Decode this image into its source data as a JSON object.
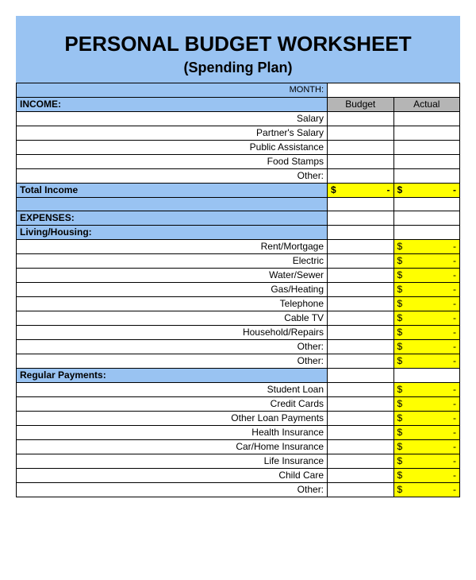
{
  "title": "PERSONAL BUDGET WORKSHEET",
  "subtitle": "(Spending Plan)",
  "month_label": "MONTH:",
  "month_value": "",
  "col_budget": "Budget",
  "col_actual": "Actual",
  "income_header": "INCOME:",
  "income_items": [
    {
      "label": "Salary",
      "budget": "",
      "actual": ""
    },
    {
      "label": "Partner's Salary",
      "budget": "",
      "actual": ""
    },
    {
      "label": "Public Assistance",
      "budget": "",
      "actual": ""
    },
    {
      "label": "Food Stamps",
      "budget": "",
      "actual": ""
    },
    {
      "label": "Other:",
      "budget": "",
      "actual": ""
    }
  ],
  "total_income_label": "Total Income",
  "total_income_budget": {
    "sym": "$",
    "dash": "-"
  },
  "total_income_actual": {
    "sym": "$",
    "dash": "-"
  },
  "expenses_header": "EXPENSES:",
  "living_header": "Living/Housing:",
  "living_items": [
    {
      "label": "Rent/Mortgage",
      "budget": "",
      "actual": {
        "sym": "$",
        "dash": "-"
      }
    },
    {
      "label": "Electric",
      "budget": "",
      "actual": {
        "sym": "$",
        "dash": "-"
      }
    },
    {
      "label": "Water/Sewer",
      "budget": "",
      "actual": {
        "sym": "$",
        "dash": "-"
      }
    },
    {
      "label": "Gas/Heating",
      "budget": "",
      "actual": {
        "sym": "$",
        "dash": "-"
      }
    },
    {
      "label": "Telephone",
      "budget": "",
      "actual": {
        "sym": "$",
        "dash": "-"
      }
    },
    {
      "label": "Cable TV",
      "budget": "",
      "actual": {
        "sym": "$",
        "dash": "-"
      }
    },
    {
      "label": "Household/Repairs",
      "budget": "",
      "actual": {
        "sym": "$",
        "dash": "-"
      }
    },
    {
      "label": "Other:",
      "budget": "",
      "actual": {
        "sym": "$",
        "dash": "-"
      }
    },
    {
      "label": "Other:",
      "budget": "",
      "actual": {
        "sym": "$",
        "dash": "-"
      }
    }
  ],
  "regular_header": "Regular Payments:",
  "regular_items": [
    {
      "label": "Student Loan",
      "budget": "",
      "actual": {
        "sym": "$",
        "dash": "-"
      }
    },
    {
      "label": "Credit Cards",
      "budget": "",
      "actual": {
        "sym": "$",
        "dash": "-"
      }
    },
    {
      "label": "Other Loan Payments",
      "budget": "",
      "actual": {
        "sym": "$",
        "dash": "-"
      }
    },
    {
      "label": "Health Insurance",
      "budget": "",
      "actual": {
        "sym": "$",
        "dash": "-"
      }
    },
    {
      "label": "Car/Home Insurance",
      "budget": "",
      "actual": {
        "sym": "$",
        "dash": "-"
      }
    },
    {
      "label": "Life Insurance",
      "budget": "",
      "actual": {
        "sym": "$",
        "dash": "-"
      }
    },
    {
      "label": "Child Care",
      "budget": "",
      "actual": {
        "sym": "$",
        "dash": "-"
      }
    },
    {
      "label": "Other:",
      "budget": "",
      "actual": {
        "sym": "$",
        "dash": "-"
      }
    }
  ]
}
